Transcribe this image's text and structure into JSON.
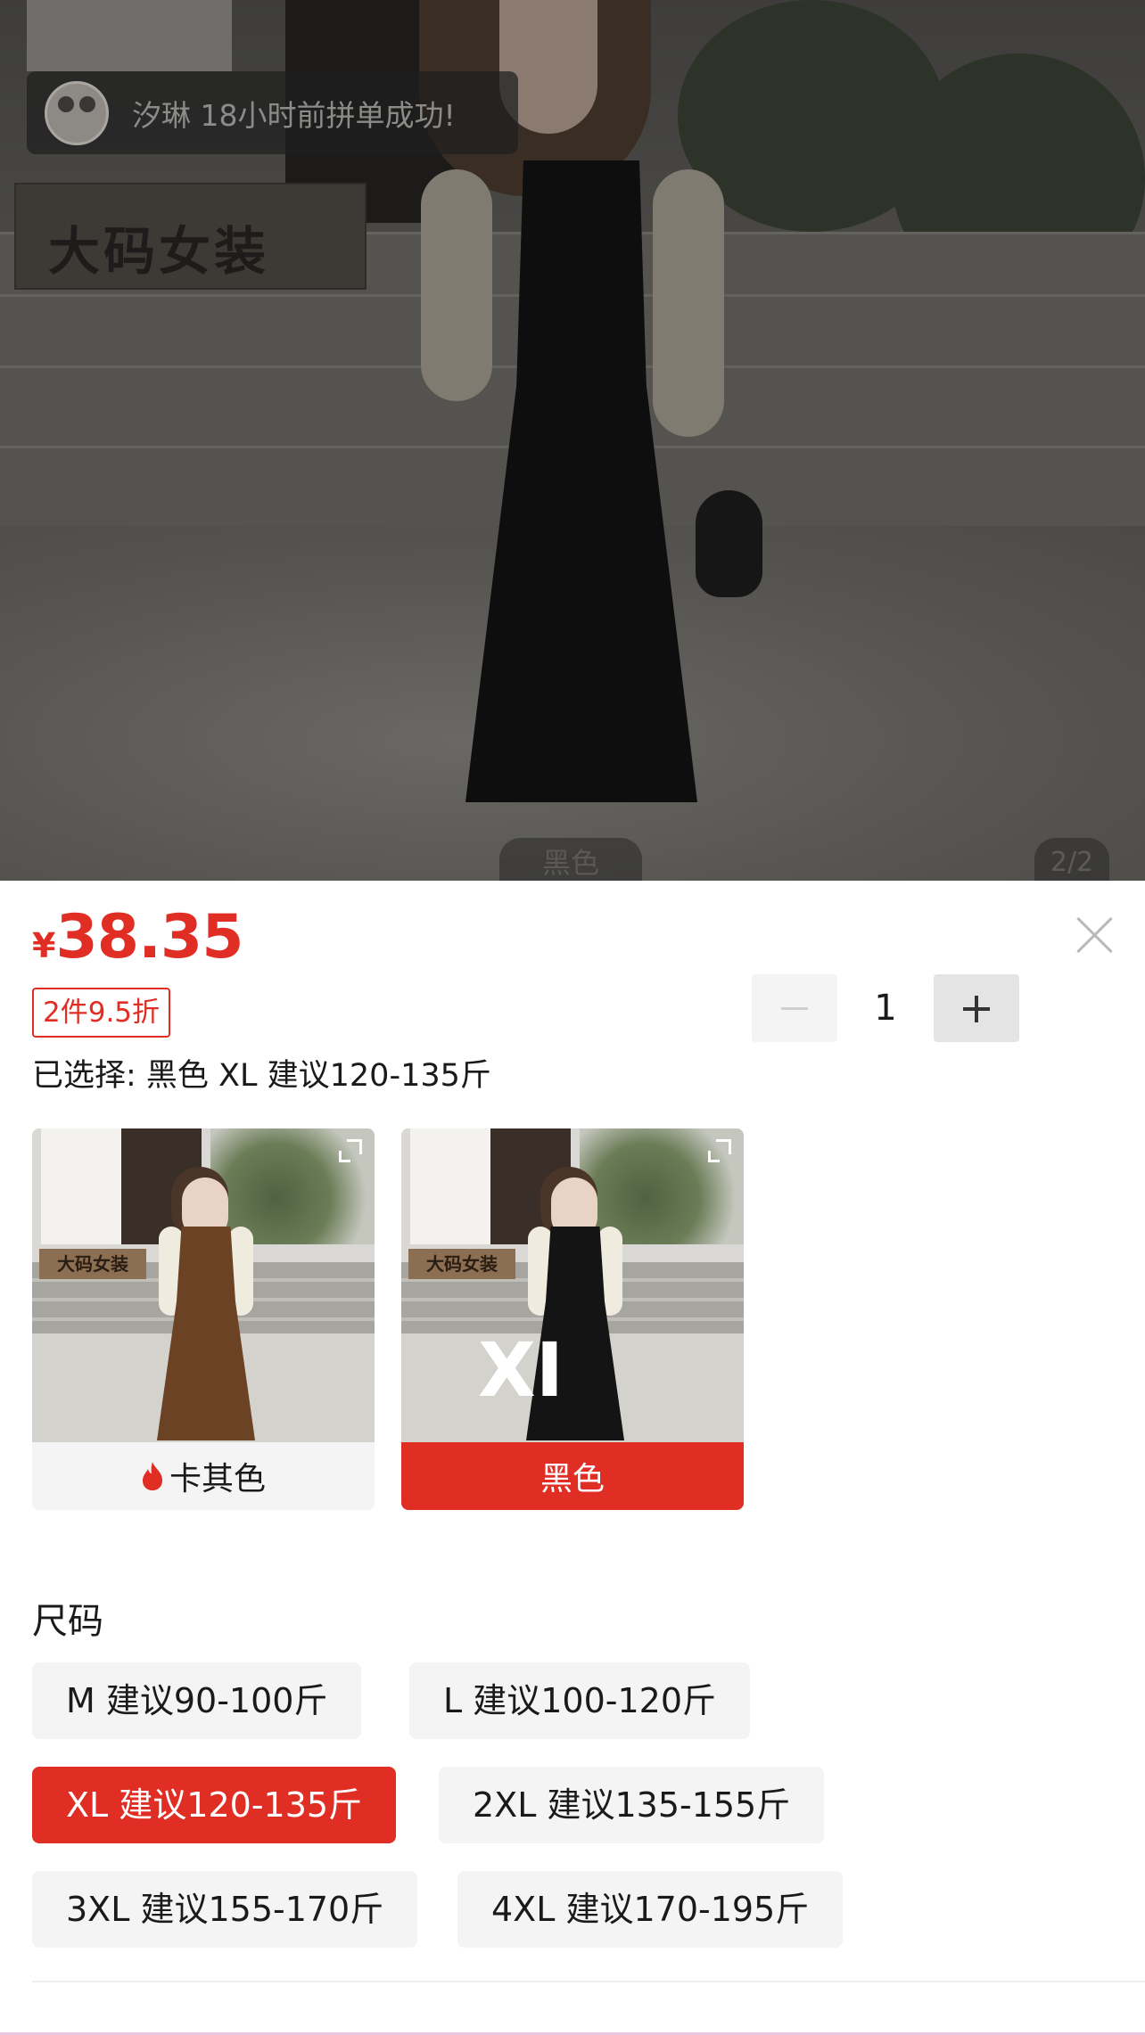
{
  "photo": {
    "sign_text": "大码女装",
    "toast": {
      "text": "汐琳 18小时前拼单成功!"
    },
    "variant_label": "黑色",
    "counter": "2/2"
  },
  "sheet": {
    "currency": "¥",
    "price": "38.35",
    "discount_tag": "2件9.5折",
    "quantity": "1",
    "selected_text": "已选择: 黑色 XL 建议120-135斤",
    "colors": [
      {
        "label": "卡其色",
        "hot": true,
        "dress_color": "#6b4224",
        "selected": false,
        "overlay": ""
      },
      {
        "label": "黑色",
        "hot": false,
        "dress_color": "#141414",
        "selected": true,
        "overlay": "XI"
      }
    ],
    "thumb_sign_text": "大码女装",
    "size_title": "尺码",
    "sizes": [
      {
        "label": "M 建议90-100斤",
        "selected": false
      },
      {
        "label": "L 建议100-120斤",
        "selected": false
      },
      {
        "label": "XL 建议120-135斤",
        "selected": true
      },
      {
        "label": "2XL 建议135-155斤",
        "selected": false
      },
      {
        "label": "3XL 建议155-170斤",
        "selected": false
      },
      {
        "label": "4XL 建议170-195斤",
        "selected": false
      }
    ]
  },
  "colors": {
    "accent": "#e02e24",
    "chip_bg": "#f4f4f4"
  },
  "icons": {
    "close": "close-icon",
    "hot": "flame-icon",
    "minus": "minus-icon",
    "plus": "plus-icon",
    "expand": "expand-icon"
  }
}
